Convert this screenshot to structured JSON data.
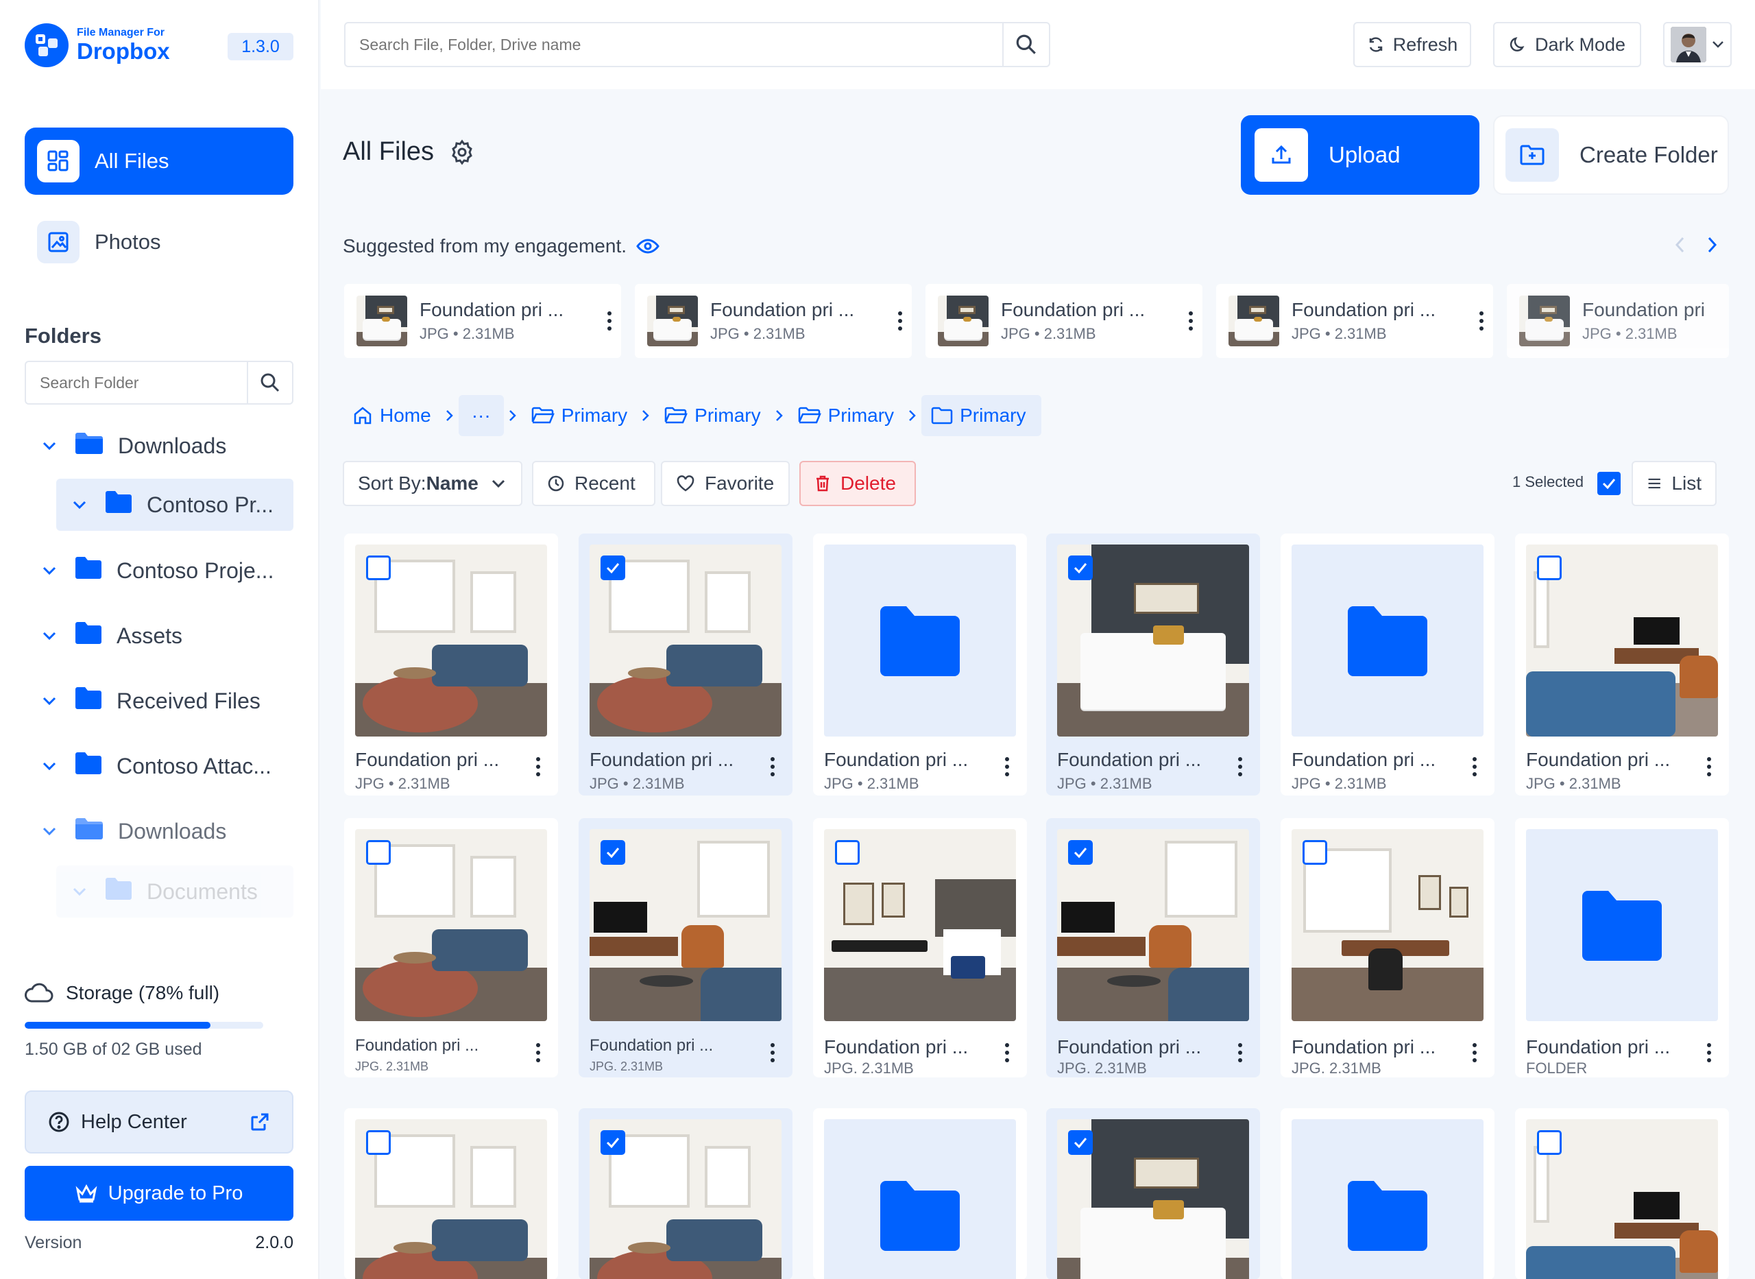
{
  "app": {
    "brand_small": "File Manager For",
    "brand_name": "Dropbox",
    "version_badge": "1.3.0",
    "accent": "#0061FE"
  },
  "sidebar": {
    "nav": [
      {
        "label": "All Files",
        "icon": "grid-icon",
        "active": true
      },
      {
        "label": "Photos",
        "icon": "image-icon",
        "active": false
      }
    ],
    "folders_title": "Folders",
    "folder_search_placeholder": "Search Folder",
    "tree": [
      {
        "label": "Downloads"
      },
      {
        "label": "Contoso Pr..."
      },
      {
        "label": "Contoso Proje..."
      },
      {
        "label": "Assets"
      },
      {
        "label": "Received Files"
      },
      {
        "label": "Contoso Attac..."
      },
      {
        "label": "Downloads"
      },
      {
        "label": "Documents"
      }
    ],
    "storage": {
      "label": "Storage (78% full)",
      "used_text": "1.50 GB of 02 GB used",
      "percent": 78
    },
    "help_label": "Help Center",
    "upgrade_label": "Upgrade to Pro",
    "version_label": "Version",
    "version_value": "2.0.0"
  },
  "header": {
    "search_placeholder": "Search File, Folder, Drive name",
    "refresh_label": "Refresh",
    "dark_mode_label": "Dark Mode"
  },
  "main": {
    "title": "All Files",
    "upload_label": "Upload",
    "create_folder_label": "Create Folder",
    "suggested_title": "Suggested from my engagement.",
    "suggested": [
      {
        "name": "Foundation pri ...",
        "meta": "JPG • 2.31MB"
      },
      {
        "name": "Foundation pri ...",
        "meta": "JPG • 2.31MB"
      },
      {
        "name": "Foundation pri ...",
        "meta": "JPG • 2.31MB"
      },
      {
        "name": "Foundation pri ...",
        "meta": "JPG • 2.31MB"
      },
      {
        "name": "Foundation pri",
        "meta": "JPG • 2.31MB"
      }
    ],
    "breadcrumb": {
      "home": "Home",
      "more": "···",
      "items": [
        "Primary",
        "Primary",
        "Primary",
        "Primary"
      ]
    },
    "toolbar": {
      "sort_prefix": "Sort By:",
      "sort_value": "Name",
      "recent_label": "Recent",
      "favorite_label": "Favorite",
      "delete_label": "Delete",
      "selected_label": "1 Selected",
      "view_label": "List"
    },
    "grid": [
      {
        "name": "Foundation pri ...",
        "meta": "JPG • 2.31MB",
        "kind": "living",
        "checked": false
      },
      {
        "name": "Foundation pri ...",
        "meta": "JPG • 2.31MB",
        "kind": "living",
        "checked": true
      },
      {
        "name": "Foundation pri ...",
        "meta": "JPG • 2.31MB",
        "kind": "folder",
        "checked": false
      },
      {
        "name": "Foundation pri ...",
        "meta": "JPG • 2.31MB",
        "kind": "bedroom",
        "checked": true
      },
      {
        "name": "Foundation pri ...",
        "meta": "JPG • 2.31MB",
        "kind": "folder",
        "checked": false
      },
      {
        "name": "Foundation pri ...",
        "meta": "JPG • 2.31MB",
        "kind": "tvroom",
        "checked": false
      },
      {
        "name": "Foundation pri ...",
        "meta": "JPG. 2.31MB",
        "kind": "living",
        "checked": false
      },
      {
        "name": "Foundation pri ...",
        "meta": "JPG. 2.31MB",
        "kind": "tvroom2",
        "checked": true
      },
      {
        "name": "Foundation pri ...",
        "meta": "JPG. 2.31MB",
        "kind": "kitchen",
        "checked": false
      },
      {
        "name": "Foundation pri ...",
        "meta": "JPG. 2.31MB",
        "kind": "tvroom2",
        "checked": true
      },
      {
        "name": "Foundation pri ...",
        "meta": "JPG. 2.31MB",
        "kind": "dining",
        "checked": false
      },
      {
        "name": "Foundation pri ...",
        "meta": "FOLDER",
        "kind": "folder",
        "checked": false
      },
      {
        "name": "",
        "meta": "",
        "kind": "living",
        "checked": false
      },
      {
        "name": "",
        "meta": "",
        "kind": "living",
        "checked": true
      },
      {
        "name": "",
        "meta": "",
        "kind": "folder",
        "checked": false
      },
      {
        "name": "",
        "meta": "",
        "kind": "bedroom",
        "checked": true
      },
      {
        "name": "",
        "meta": "",
        "kind": "folder",
        "checked": false
      },
      {
        "name": "",
        "meta": "",
        "kind": "tvroom",
        "checked": false
      }
    ]
  }
}
